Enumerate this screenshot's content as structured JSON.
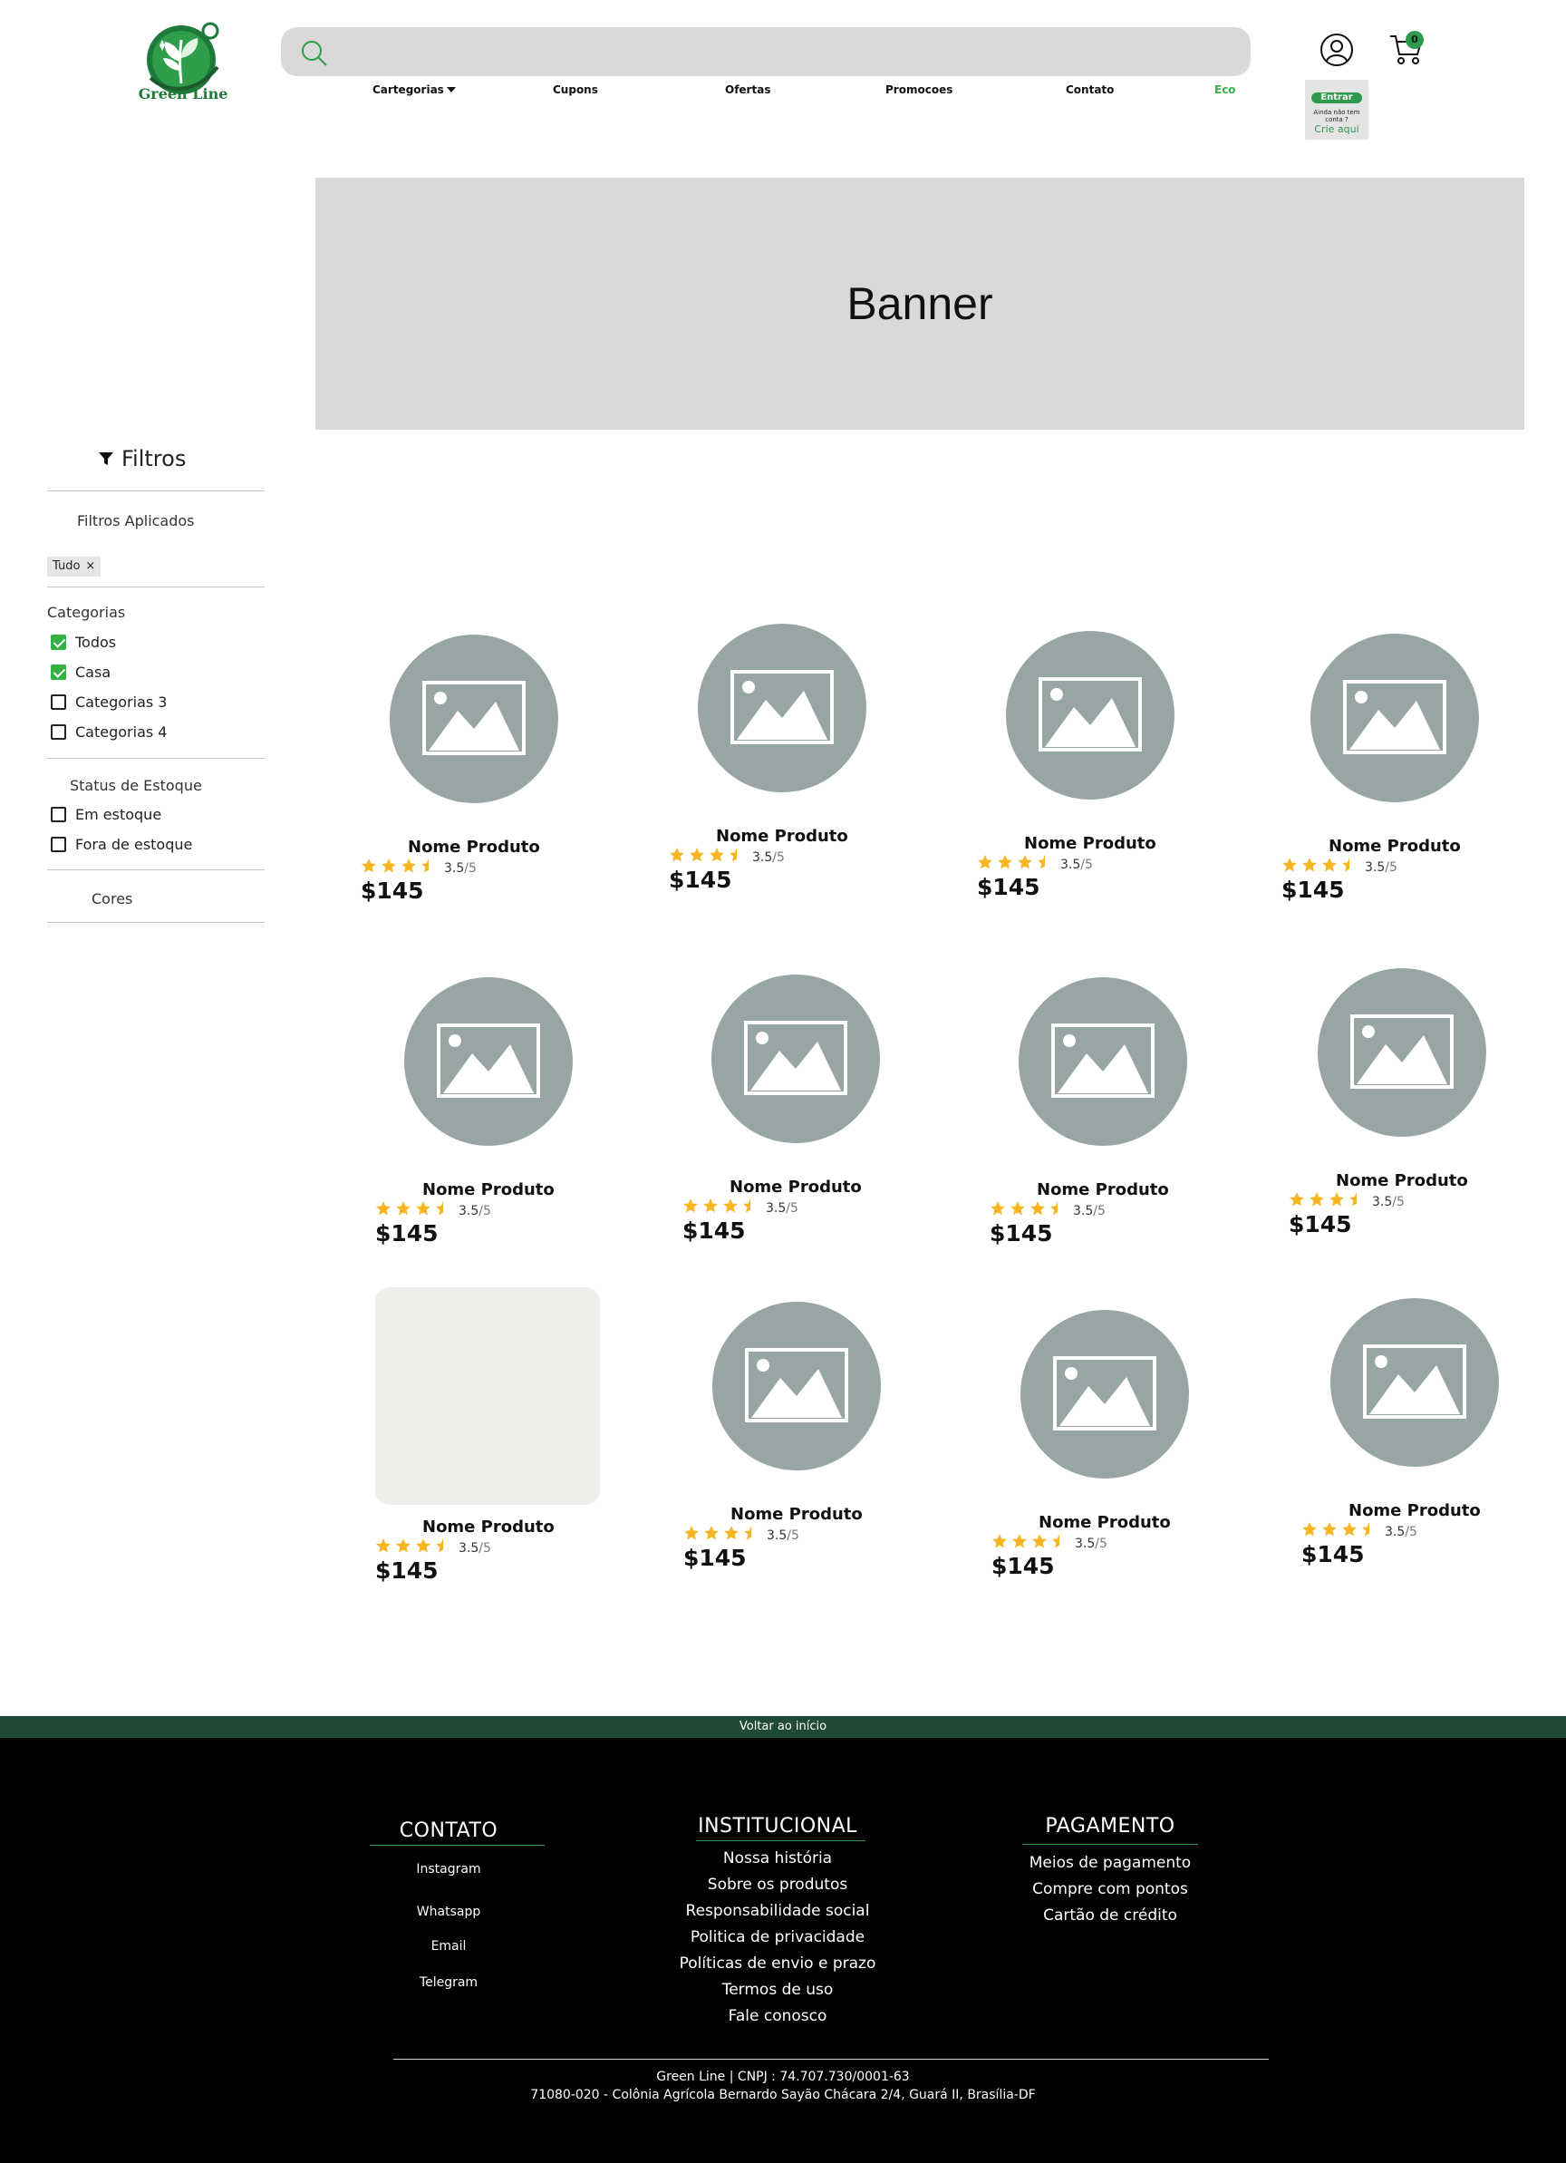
{
  "brand": {
    "name": "Green Line",
    "primary_color": "#2f9a4c",
    "dark_green": "#1f4a38"
  },
  "search": {
    "placeholder": "",
    "icon": "search-icon"
  },
  "nav": {
    "items": [
      {
        "label": "Cartegorias",
        "icon": "caret-down-icon"
      },
      {
        "label": "Cupons"
      },
      {
        "label": "Ofertas"
      },
      {
        "label": "Promocoes"
      },
      {
        "label": "Contato"
      },
      {
        "label": "Eco",
        "color": "#34b246"
      }
    ]
  },
  "header": {
    "user_icon": "user-icon",
    "cart_icon": "cart-icon",
    "cart_count": "0",
    "login": {
      "button_label": "Entrar",
      "hint": "Ainda não tem conta ?",
      "link_label": "Crie aqui"
    }
  },
  "banner": {
    "text": "Banner"
  },
  "sidebar": {
    "title": "Filtros",
    "applied_title": "Filtros Aplicados",
    "applied_chips": [
      {
        "label": "Tudo",
        "remove": "×"
      }
    ],
    "categories_title": "Categorias",
    "categories": [
      {
        "label": "Todos",
        "checked": true
      },
      {
        "label": "Casa",
        "checked": true
      },
      {
        "label": "Categorias 3",
        "checked": false
      },
      {
        "label": "Categorias 4",
        "checked": false
      }
    ],
    "stock_title": "Status de Estoque",
    "stock": [
      {
        "label": "Em estoque",
        "checked": false
      },
      {
        "label": "Fora de estoque",
        "checked": false
      }
    ],
    "colors_title": "Cores"
  },
  "products": [
    {
      "name": "Nome Produto",
      "rating": "3.5",
      "rating_max": "/5",
      "price": "$145",
      "stars": 3.5,
      "image": "image-placeholder-icon"
    },
    {
      "name": "Nome Produto",
      "rating": "3.5",
      "rating_max": "/5",
      "price": "$145",
      "stars": 3.5,
      "image": "image-placeholder-icon"
    },
    {
      "name": "Nome Produto",
      "rating": "3.5",
      "rating_max": "/5",
      "price": "$145",
      "stars": 3.5,
      "image": "image-placeholder-icon"
    },
    {
      "name": "Nome Produto",
      "rating": "3.5",
      "rating_max": "/5",
      "price": "$145",
      "stars": 3.5,
      "image": "image-placeholder-icon"
    },
    {
      "name": "Nome Produto",
      "rating": "3.5",
      "rating_max": "/5",
      "price": "$145",
      "stars": 3.5,
      "image": "image-placeholder-icon"
    },
    {
      "name": "Nome Produto",
      "rating": "3.5",
      "rating_max": "/5",
      "price": "$145",
      "stars": 3.5,
      "image": "image-placeholder-icon"
    },
    {
      "name": "Nome Produto",
      "rating": "3.5",
      "rating_max": "/5",
      "price": "$145",
      "stars": 3.5,
      "image": "image-placeholder-icon"
    },
    {
      "name": "Nome Produto",
      "rating": "3.5",
      "rating_max": "/5",
      "price": "$145",
      "stars": 3.5,
      "image": "image-placeholder-icon"
    },
    {
      "name": "Nome Produto",
      "rating": "3.5",
      "rating_max": "/5",
      "price": "$145",
      "stars": 3.5,
      "image": "blank-image"
    },
    {
      "name": "Nome Produto",
      "rating": "3.5",
      "rating_max": "/5",
      "price": "$145",
      "stars": 3.5,
      "image": "image-placeholder-icon"
    },
    {
      "name": "Nome Produto",
      "rating": "3.5",
      "rating_max": "/5",
      "price": "$145",
      "stars": 3.5,
      "image": "image-placeholder-icon"
    },
    {
      "name": "Nome Produto",
      "rating": "3.5",
      "rating_max": "/5",
      "price": "$145",
      "stars": 3.5,
      "image": "image-placeholder-icon"
    }
  ],
  "footer": {
    "back_to_top": "Voltar ao início",
    "contato": {
      "title": "CONTATO",
      "links": [
        "Instagram",
        "Whatsapp",
        "Email",
        "Telegram"
      ]
    },
    "institucional": {
      "title": "INSTITUCIONAL",
      "links": [
        "Nossa história",
        "Sobre os produtos",
        "Responsabilidade social",
        "Politica de privacidade",
        "Políticas de envio e prazo",
        "Termos de uso",
        "Fale conosco"
      ]
    },
    "pagamento": {
      "title": "PAGAMENTO",
      "links": [
        "Meios de pagamento",
        "Compre com pontos",
        "Cartão de crédito"
      ]
    },
    "company_line": "Green Line | CNPJ : 74.707.730/0001-63",
    "address_line": "71080-020 - Colônia Agrícola Bernardo Sayão Chácara 2/4, Guará II, Brasília-DF"
  }
}
